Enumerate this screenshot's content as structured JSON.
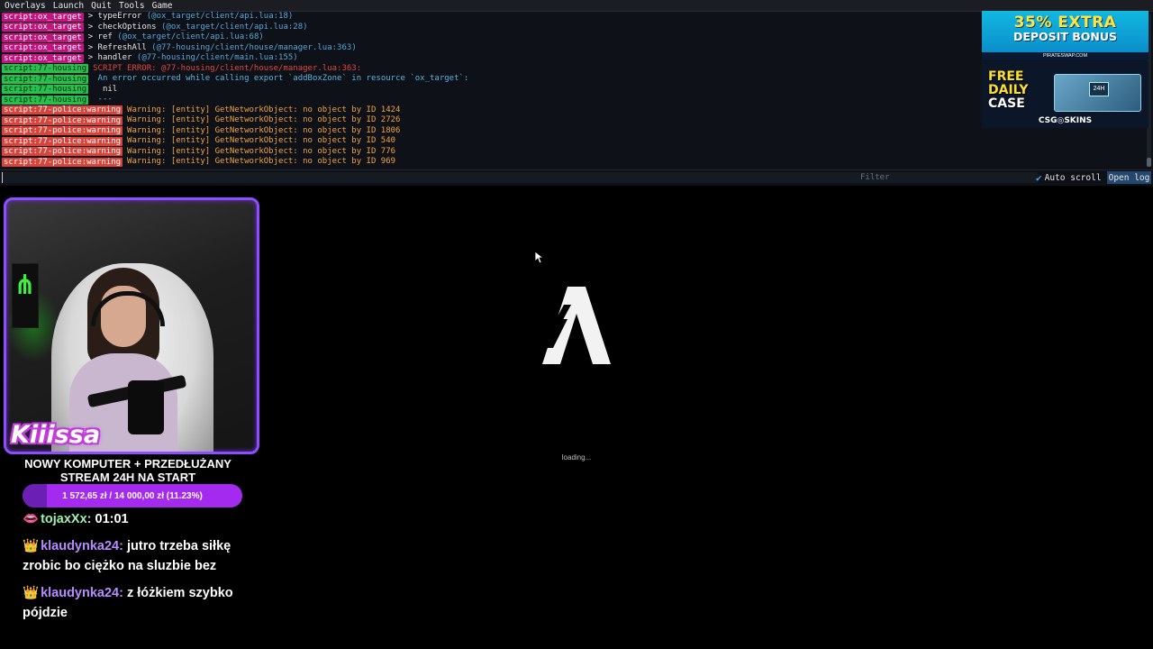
{
  "menubar": {
    "items": [
      "Overlays",
      "Launch",
      "Quit",
      "Tools",
      "Game"
    ]
  },
  "console": {
    "lines": [
      {
        "channel": "script:ox_target",
        "kind": "target",
        "gt": "> ",
        "fn": "typeError",
        "path": "(@ox_target/client/api.lua:18)",
        "style": "trace"
      },
      {
        "channel": "script:ox_target",
        "kind": "target",
        "gt": "> ",
        "fn": "checkOptions",
        "path": "(@ox_target/client/api.lua:28)",
        "style": "trace"
      },
      {
        "channel": "script:ox_target",
        "kind": "target",
        "gt": "> ",
        "fn": "ref",
        "path": "(@ox_target/client/api.lua:68)",
        "style": "trace"
      },
      {
        "channel": "script:ox_target",
        "kind": "target",
        "gt": "> ",
        "fn": "RefreshAll",
        "path": "(@77-housing/client/house/manager.lua:363)",
        "style": "trace"
      },
      {
        "channel": "script:ox_target",
        "kind": "target",
        "gt": "> ",
        "fn": "handler",
        "path": "(@77-housing/client/main.lua:155)",
        "style": "trace"
      },
      {
        "channel": "script:77-housing",
        "kind": "housing",
        "text": "SCRIPT ERROR: @77-housing/client/house/manager.lua:363:",
        "style": "err"
      },
      {
        "channel": "script:77-housing",
        "kind": "housing",
        "text": " An error occurred while calling export `addBoxZone` in resource `ox_target`:",
        "style": "info"
      },
      {
        "channel": "script:77-housing",
        "kind": "housing",
        "text": "  nil",
        "style": "plain"
      },
      {
        "channel": "script:77-housing",
        "kind": "housing",
        "text": " ---",
        "style": "info"
      },
      {
        "channel": "script:77-police:warning",
        "kind": "police",
        "text": "Warning: [entity] GetNetworkObject: no object by ID 1424",
        "style": "warn"
      },
      {
        "channel": "script:77-police:warning",
        "kind": "police",
        "text": "Warning: [entity] GetNetworkObject: no object by ID 2726",
        "style": "warn"
      },
      {
        "channel": "script:77-police:warning",
        "kind": "police",
        "text": "Warning: [entity] GetNetworkObject: no object by ID 1806",
        "style": "warn"
      },
      {
        "channel": "script:77-police:warning",
        "kind": "police",
        "text": "Warning: [entity] GetNetworkObject: no object by ID 540",
        "style": "warn"
      },
      {
        "channel": "script:77-police:warning",
        "kind": "police",
        "text": "Warning: [entity] GetNetworkObject: no object by ID 776",
        "style": "warn"
      },
      {
        "channel": "script:77-police:warning",
        "kind": "police",
        "text": "Warning: [entity] GetNetworkObject: no object by ID 969",
        "style": "warn"
      }
    ],
    "channel_colors": {
      "target": "#c0177f",
      "housing": "#27c04c",
      "police": "#d9443a"
    }
  },
  "console_input": {
    "value": "",
    "filter_placeholder": "Filter",
    "autoscroll_label": "Auto scroll",
    "autoscroll_checked": true,
    "openlog_label": "Open log"
  },
  "ads": {
    "ad1": {
      "line1": "35% EXTRA",
      "line2": "DEPOSIT BONUS",
      "line3": "PIRATESWAP.COM"
    },
    "ad2": {
      "free": "FREE",
      "daily": "DAILY",
      "case": "CASE",
      "tag": "24H",
      "brand": "CSG◎SKINS"
    }
  },
  "stream": {
    "streamer_name": "Kiiissa",
    "title_line1": "NOWY KOMPUTER + PRZEDŁUŻANY",
    "title_line2": "STREAM 24H NA START",
    "goal_text": "1 572,65 zł / 14 000,00 zł (11.23%)",
    "goal_percent": 11.23,
    "accent_color": "#8e4dff"
  },
  "chat": [
    {
      "badge": "lips-icon",
      "badge_glyph": "👄",
      "user": "tojaxXx:",
      "text": " 01:01",
      "color": "green"
    },
    {
      "badge": "crown-icon",
      "badge_glyph": "👑",
      "user": "klaudynka24:",
      "text": " jutro trzeba siłkę zrobic bo ciężko na sluzbie bez",
      "color": "purple"
    },
    {
      "badge": "crown-icon",
      "badge_glyph": "👑",
      "user": "klaudynka24:",
      "text": " z łóżkiem szybko pójdzie",
      "color": "purple"
    }
  ],
  "loading": {
    "text": "loading..."
  }
}
